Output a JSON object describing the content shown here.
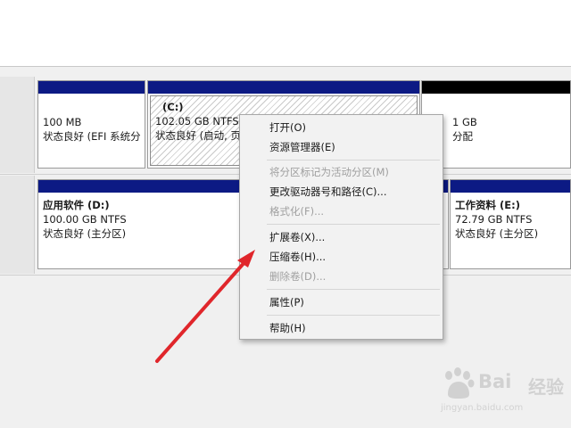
{
  "disk_rows": [
    {
      "partitions": [
        {
          "title": "",
          "size": "100 MB",
          "status": "状态良好 (EFI 系统分",
          "type": "primary"
        },
        {
          "title": "(C:)",
          "size": "102.05 GB NTFS",
          "status": "状态良好 (启动, 页",
          "type": "primary-selected"
        },
        {
          "title": "",
          "size": "1 GB",
          "status": "分配",
          "type": "unallocated"
        }
      ]
    },
    {
      "partitions": [
        {
          "title": "应用软件   (D:)",
          "size": "100.00 GB NTFS",
          "status": "状态良好 (主分区)",
          "type": "primary"
        },
        {
          "title": "工作资料   (E:)",
          "size": "72.79 GB NTFS",
          "status": "状态良好 (主分区)",
          "type": "primary"
        }
      ]
    }
  ],
  "context_menu": {
    "items": [
      {
        "label": "打开(O)",
        "enabled": true
      },
      {
        "label": "资源管理器(E)",
        "enabled": true
      },
      {
        "label": "将分区标记为活动分区(M)",
        "enabled": false
      },
      {
        "label": "更改驱动器号和路径(C)...",
        "enabled": true
      },
      {
        "label": "格式化(F)...",
        "enabled": false
      },
      {
        "label": "扩展卷(X)...",
        "enabled": true
      },
      {
        "label": "压缩卷(H)...",
        "enabled": true
      },
      {
        "label": "删除卷(D)...",
        "enabled": false
      },
      {
        "label": "属性(P)",
        "enabled": true
      },
      {
        "label": "帮助(H)",
        "enabled": true
      }
    ]
  },
  "annotation": {
    "arrow_color": "#e0262b"
  },
  "watermark": {
    "brand": "Bai",
    "brand_suffix": "经验",
    "url": "jingyan.baidu.com"
  },
  "colors": {
    "partition_bar": "#0c1a84",
    "unallocated_bar": "#000000"
  }
}
